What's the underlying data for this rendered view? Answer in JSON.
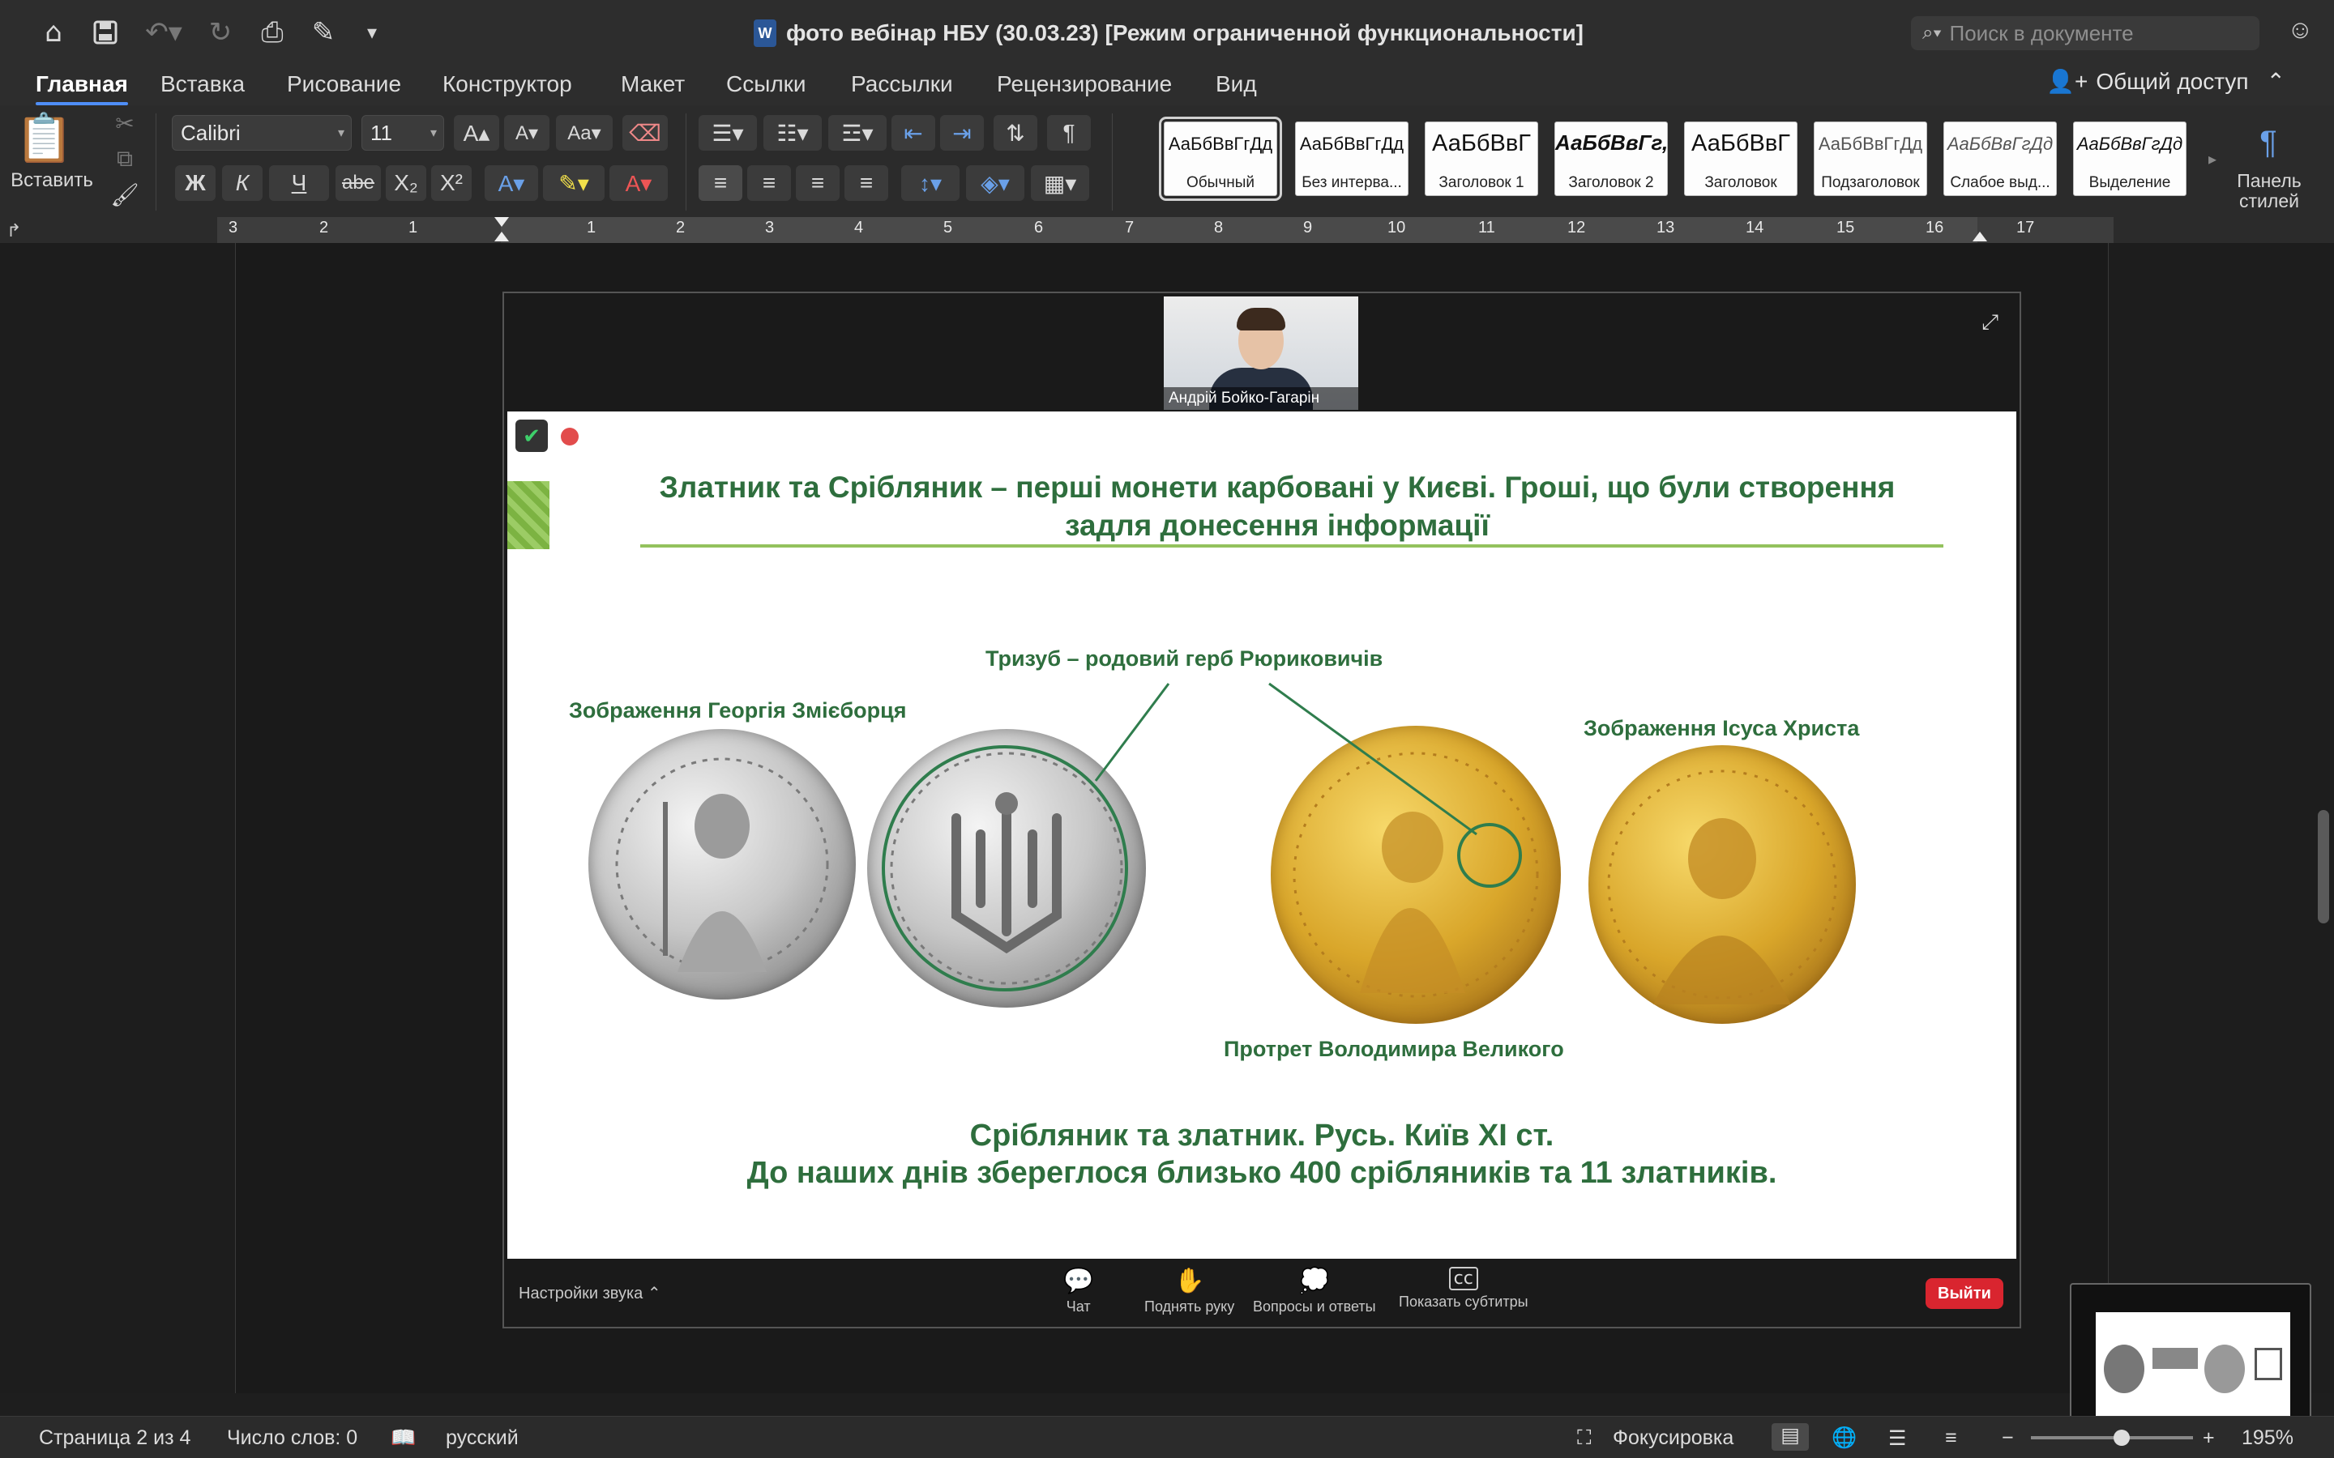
{
  "window": {
    "title": "фото вебінар НБУ (30.03.23) [Режим ограниченной функциональности]",
    "search_placeholder": "Поиск в документе"
  },
  "tabs": [
    "Главная",
    "Вставка",
    "Рисование",
    "Конструктор",
    "Макет",
    "Ссылки",
    "Рассылки",
    "Рецензирование",
    "Вид"
  ],
  "share_label": "Общий доступ",
  "ribbon": {
    "paste_label": "Вставить",
    "font_name": "Calibri",
    "font_size": "11",
    "bold": "Ж",
    "italic": "К",
    "underline": "Ч",
    "strike": "abe",
    "styles_panel_label": "Панель стилей",
    "styles": [
      {
        "preview": "АаБбВвГгДд",
        "caption": "Обычный"
      },
      {
        "preview": "АаБбВвГгДд",
        "caption": "Без интерва..."
      },
      {
        "preview": "АаБбВвГ",
        "caption": "Заголовок 1"
      },
      {
        "preview": "АаБбВвГг,",
        "caption": "Заголовок 2"
      },
      {
        "preview": "АаБбВвГ",
        "caption": "Заголовок"
      },
      {
        "preview": "АаБбВвГгДд",
        "caption": "Подзаголовок"
      },
      {
        "preview": "АаБбВвГгДд",
        "caption": "Слабое выд..."
      },
      {
        "preview": "АаБбВвГгДд",
        "caption": "Выделение"
      }
    ]
  },
  "ruler_numbers": [
    "3",
    "2",
    "1",
    "1",
    "2",
    "3",
    "4",
    "5",
    "6",
    "7",
    "8",
    "9",
    "10",
    "11",
    "12",
    "13",
    "14",
    "15",
    "16",
    "17"
  ],
  "zoom": {
    "participant_name": "Андрій Бойко-Гагарін",
    "controls": {
      "sound": "Настройки звука",
      "chat": "Чат",
      "raise_hand": "Поднять руку",
      "qa": "Вопросы и ответы",
      "captions": "Показать субтитры",
      "leave": "Выйти"
    }
  },
  "slide": {
    "title": "Златник та Срібляник – перші монети карбовані у Києві. Гроші, що були створення задля донесення інформації",
    "label_trident": "Тризуб – родовий герб Рюриковичів",
    "label_george": "Зображення Георгія Змієборця",
    "label_jesus": "Зображення Ісуса Христа",
    "label_volodymyr": "Протрет Володимира Великого",
    "caption_line1": "Срібляник та златник. Русь. Київ XI ст.",
    "caption_line2": "До наших днів збереглося близько 400 срібляників та 11 златників."
  },
  "status": {
    "page": "Страница 2 из 4",
    "words": "Число слов: 0",
    "language": "русский",
    "focus": "Фокусировка",
    "zoom": "195%"
  }
}
